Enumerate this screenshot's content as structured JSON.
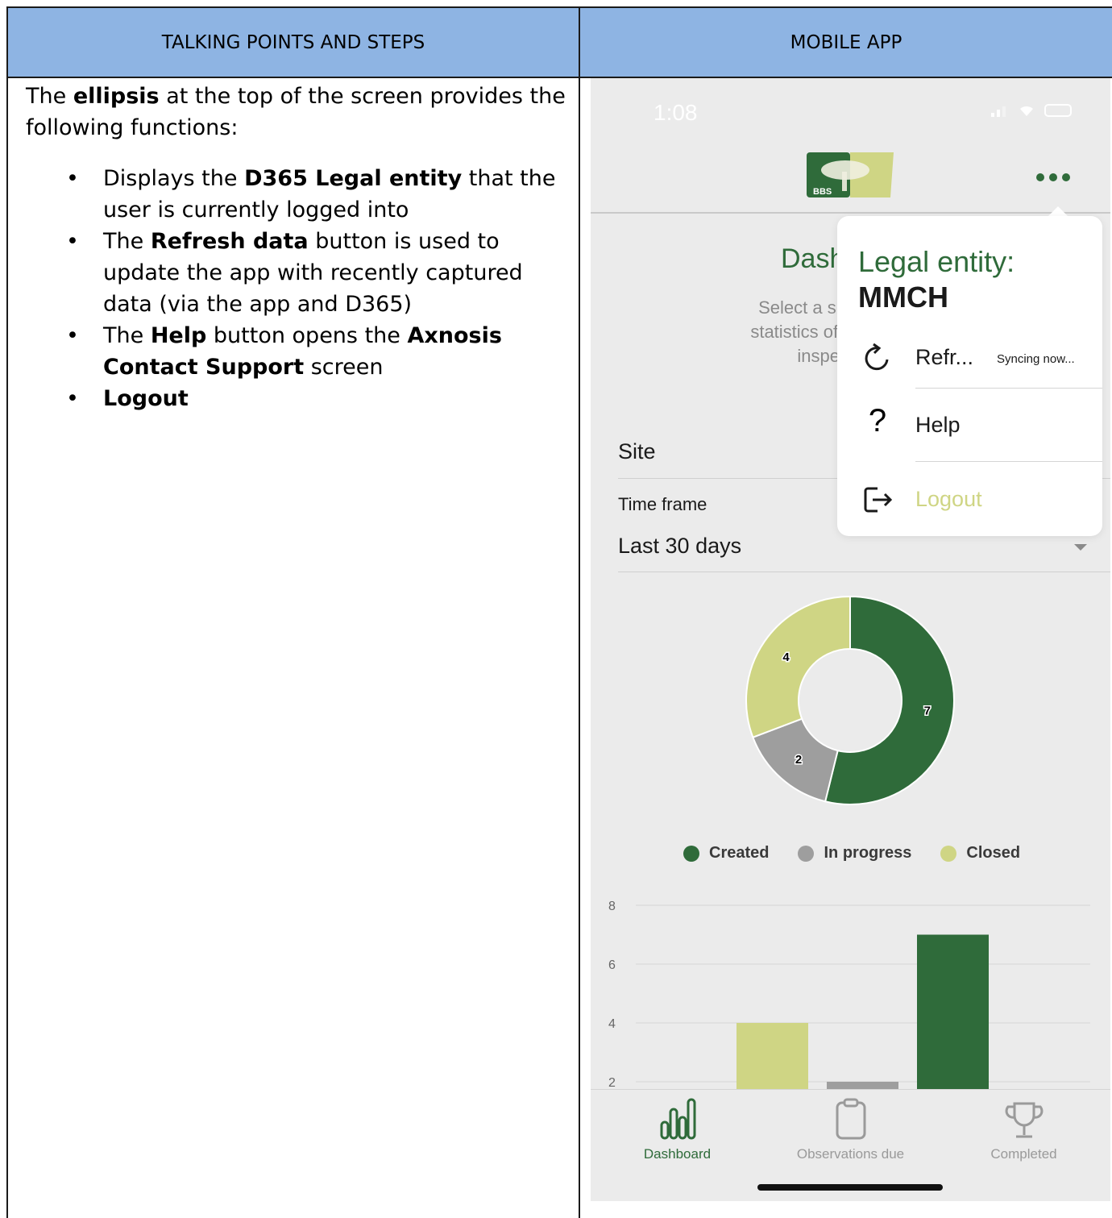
{
  "doc": {
    "header_left": "TALKING POINTS AND STEPS",
    "header_right": "MOBILE APP",
    "intro": {
      "pre": "The ",
      "bold": "ellipsis",
      "post": " at the top of the screen provides the following functions:"
    },
    "bullets": [
      {
        "pre": "Displays the ",
        "bold": "D365 Legal entity",
        "post": " that the user is currently logged into"
      },
      {
        "pre": "The ",
        "bold": "Refresh data",
        "post": " button is used to update the app with recently captured data (via the app and D365)"
      },
      {
        "pre": "The ",
        "bold": "Help",
        "mid": " button opens the ",
        "bold2": "Axnosis Contact Support",
        "post": " screen"
      },
      {
        "pre": "",
        "bold": "Logout",
        "post": ""
      }
    ]
  },
  "phone": {
    "status_time": "1:08",
    "logo_text": "BBS",
    "dashboard_title": "Dash",
    "subtitle_lines": [
      "Select a site & optional",
      "statistics of the number c",
      "inspections y"
    ],
    "site_label": "Site",
    "timeframe_label": "Time frame",
    "timeframe_value": "Last 30 days",
    "menu": {
      "legal_entity_label": "Legal entity:",
      "legal_entity_value": "MMCH",
      "refresh_label": "Refr...",
      "refresh_status": "Syncing now...",
      "help_label": "Help",
      "logout_label": "Logout"
    },
    "tabs": [
      {
        "label": "Dashboard",
        "icon": "bar-chart-icon",
        "active": true
      },
      {
        "label": "Observations due",
        "icon": "clipboard-icon",
        "active": false
      },
      {
        "label": "Completed",
        "icon": "trophy-icon",
        "active": false
      }
    ],
    "colors": {
      "created": "#2f6b3a",
      "in_progress": "#9e9e9e",
      "closed": "#cfd584"
    }
  },
  "chart_data": [
    {
      "type": "pie",
      "categories": [
        "Created",
        "In progress",
        "Closed"
      ],
      "values": [
        7,
        2,
        4
      ],
      "legend": [
        "Created",
        "In progress",
        "Closed"
      ]
    },
    {
      "type": "bar",
      "categories": [
        "Closed",
        "In progress",
        "Created"
      ],
      "values": [
        4,
        2,
        7
      ],
      "yticks": [
        "8",
        "6",
        "4",
        "2"
      ],
      "ylim": [
        0,
        8
      ]
    }
  ]
}
